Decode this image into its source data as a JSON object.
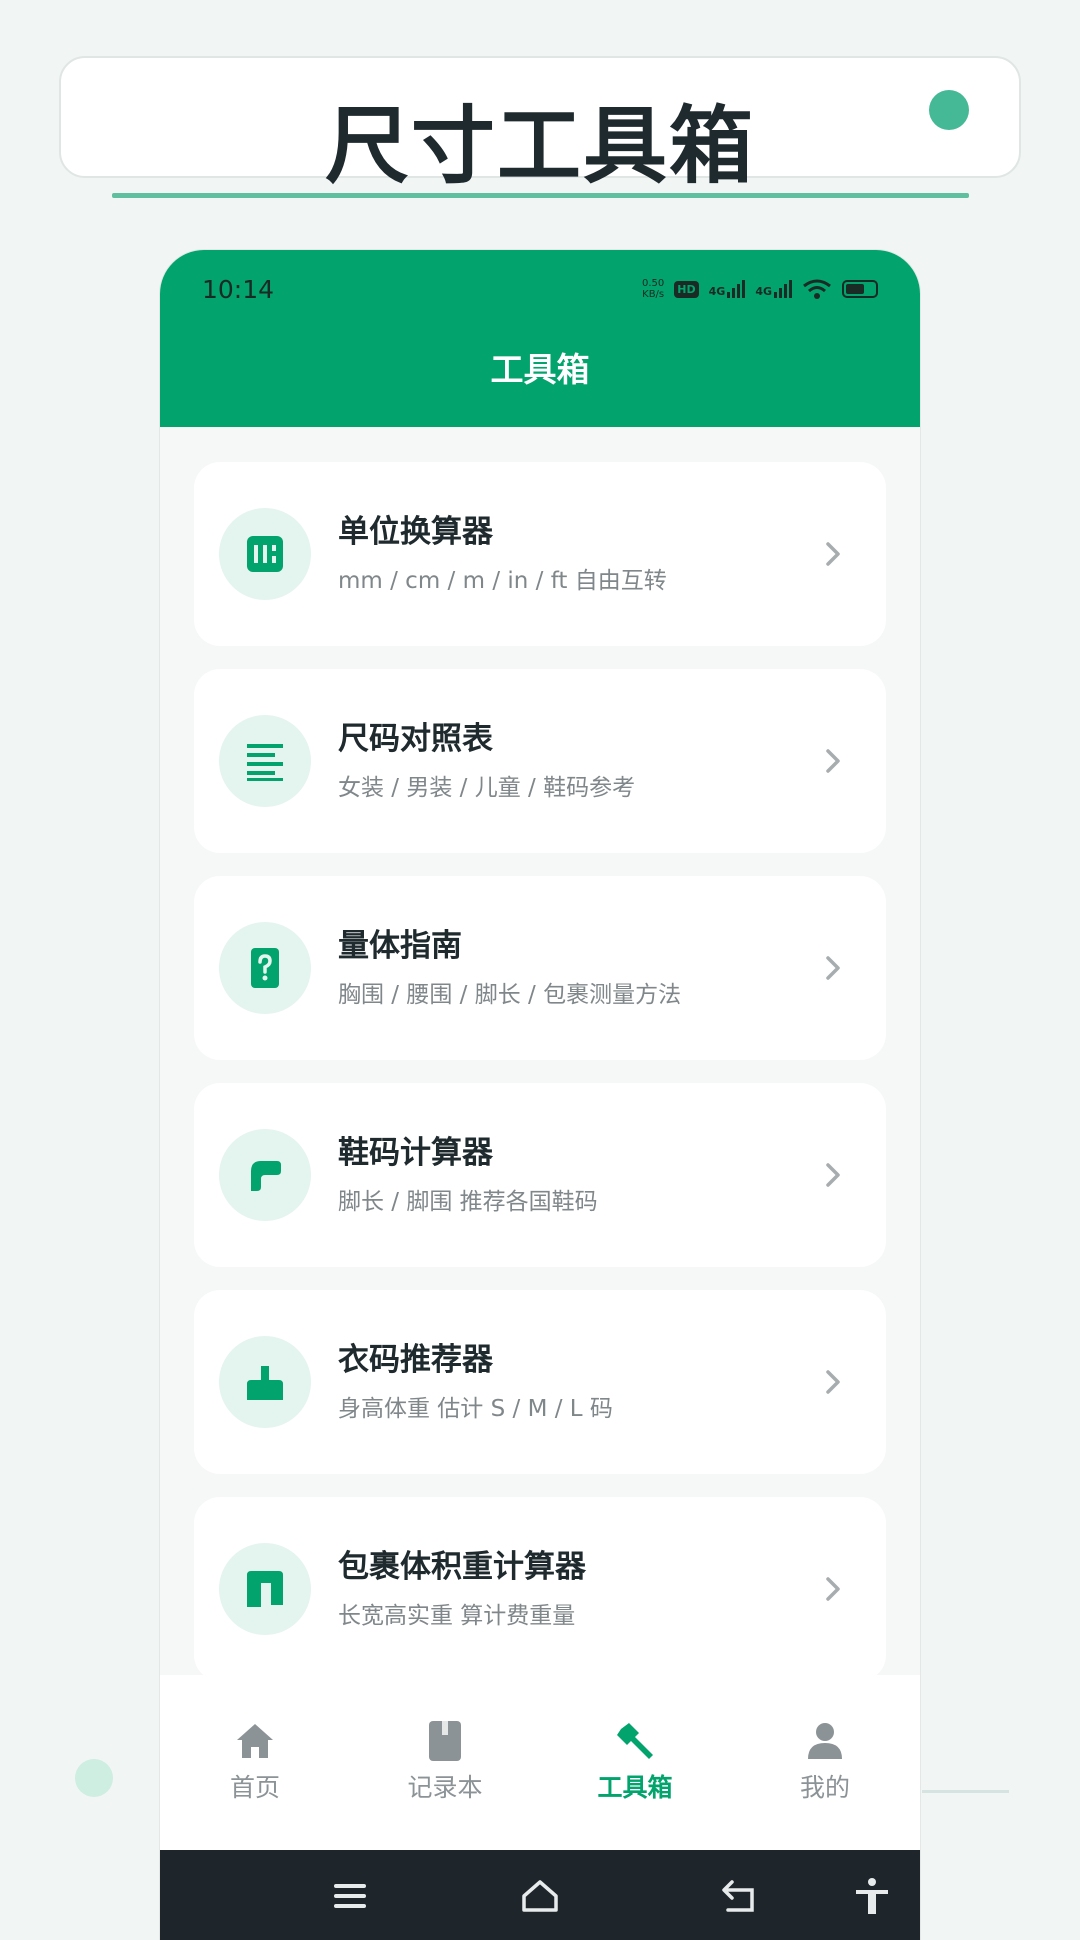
{
  "banner": {
    "title": "尺寸工具箱"
  },
  "status": {
    "time": "10:14",
    "speed_value": "0.50",
    "speed_unit": "KB/s",
    "hd": "HD",
    "net1": "4G",
    "net2": "4G"
  },
  "header": {
    "title": "工具箱"
  },
  "tools": [
    {
      "title": "单位换算器",
      "subtitle": "mm / cm / m / in / ft 自由互转",
      "icon": "ruler-icon"
    },
    {
      "title": "尺码对照表",
      "subtitle": "女装 / 男装 / 儿童 / 鞋码参考",
      "icon": "list-icon"
    },
    {
      "title": "量体指南",
      "subtitle": "胸围 / 腰围 / 脚长 / 包裹测量方法",
      "icon": "help-card-icon"
    },
    {
      "title": "鞋码计算器",
      "subtitle": "脚长 / 脚围 推荐各国鞋码",
      "icon": "shoe-icon"
    },
    {
      "title": "衣码推荐器",
      "subtitle": "身高体重 估计 S / M / L 码",
      "icon": "shirt-icon"
    },
    {
      "title": "包裹体积重计算器",
      "subtitle": "长宽高实重 算计费重量",
      "icon": "package-icon"
    }
  ],
  "tabbar": {
    "items": [
      {
        "label": "首页",
        "icon": "home-icon",
        "active": false
      },
      {
        "label": "记录本",
        "icon": "notebook-icon",
        "active": false
      },
      {
        "label": "工具箱",
        "icon": "toolbox-icon",
        "active": true
      },
      {
        "label": "我的",
        "icon": "person-icon",
        "active": false
      }
    ]
  },
  "colors": {
    "accent": "#02a36c",
    "accent_light": "#e4f4ee",
    "text": "#1f2a2e",
    "subtext": "#80878a",
    "inactive_tab": "#8c9396"
  }
}
